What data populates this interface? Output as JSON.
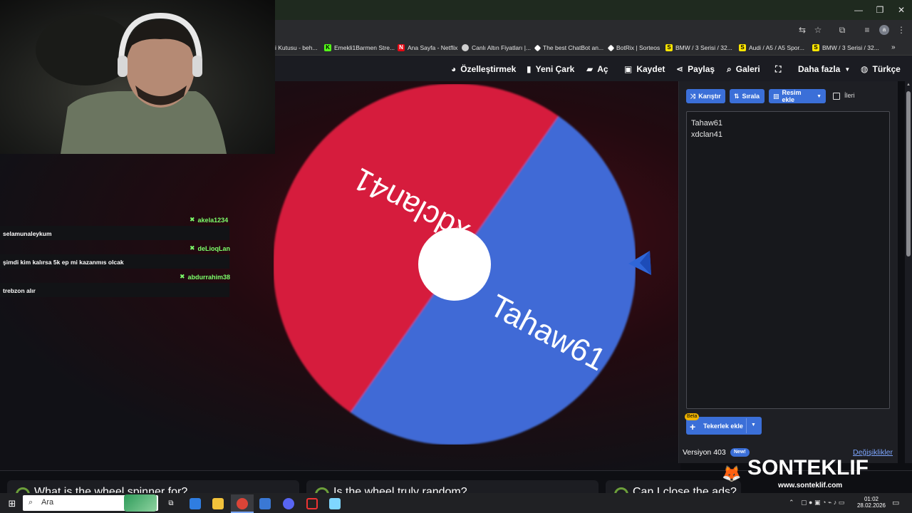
{
  "bookmarks": [
    {
      "label": "i Kutusu - beh...",
      "color": "#8a8a8a"
    },
    {
      "label": "Emekli1Barmen Stre...",
      "color": "#53fc18"
    },
    {
      "label": "Ana Sayfa - Netflix",
      "color": "#e50914"
    },
    {
      "label": "Canlı Altın Fiyatları |...",
      "color": "#cfcfcf"
    },
    {
      "label": "The best ChatBot an...",
      "color": "#ffffff"
    },
    {
      "label": "BotRix | Sorteos",
      "color": "#ffffff"
    },
    {
      "label": "BMW / 3 Serisi / 32...",
      "color": "#ffe600"
    },
    {
      "label": "Audi / A5 / A5 Spor...",
      "color": "#ffe600"
    },
    {
      "label": "BMW / 3 Serisi / 32...",
      "color": "#ffe600"
    }
  ],
  "toolbar": {
    "customize": "Özelleştirmek",
    "new_wheel": "Yeni Çark",
    "open": "Aç",
    "save": "Kaydet",
    "share": "Paylaş",
    "gallery": "Galeri",
    "more": "Daha fazla",
    "language": "Türkçe"
  },
  "wheel": {
    "segments": [
      {
        "label": "xdclan41",
        "color": "#d61f3c"
      },
      {
        "label": "Tahaw61",
        "color": "#3f6bd6"
      }
    ]
  },
  "panel": {
    "shuffle": "Karıştır",
    "sort": "Sırala",
    "add_image": "Resim ekle",
    "advanced": "İleri",
    "entries": [
      "Tahaw61",
      "xdclan41"
    ],
    "beta": "Beta",
    "add_wheel": "Tekerlek ekle",
    "version": "Versiyon 403",
    "new_badge": "New!",
    "changes": "Değişiklikler"
  },
  "chat": [
    {
      "user": "akela1234",
      "message": "selamunaleykum"
    },
    {
      "user": "deLioqLan",
      "message": "şimdi kim kalırsa 5k ep mi kazanmıs olcak"
    },
    {
      "user": "abdurrahim38",
      "message": "trebzon alır"
    }
  ],
  "faq": [
    "What is the wheel spinner for?",
    "Is the wheel truly random?",
    "Can I close the ads?"
  ],
  "watermark": {
    "brand": "SONTEKLIF",
    "url": "www.sonteklif.com"
  },
  "taskbar": {
    "search_placeholder": "Ara",
    "time": "01:02",
    "date": "28.02.2026"
  }
}
